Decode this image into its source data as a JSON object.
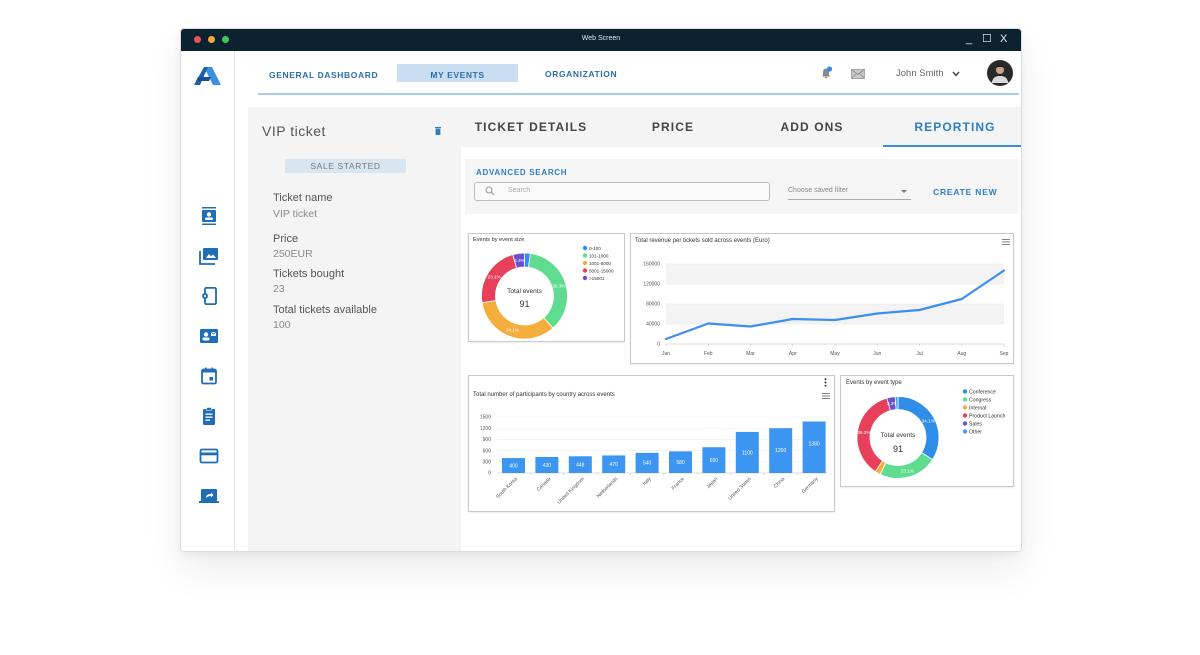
{
  "window": {
    "title": "Web Screen",
    "controls": {
      "minimize": "_",
      "maximize": "☐",
      "close": "X"
    }
  },
  "nav": {
    "items": [
      {
        "label": "GENERAL DASHBOARD",
        "active": false
      },
      {
        "label": "MY EVENTS",
        "active": true
      },
      {
        "label": "ORGANIZATION",
        "active": false
      }
    ],
    "user_name": "John Smith",
    "icons": [
      "bell-icon",
      "mail-icon",
      "chevron-down-icon",
      "avatar"
    ]
  },
  "sidebar": {
    "items": [
      {
        "icon": "contact-badge-icon"
      },
      {
        "icon": "photo-library-icon"
      },
      {
        "icon": "device-settings-icon"
      },
      {
        "icon": "id-card-icon"
      },
      {
        "icon": "calendar-icon"
      },
      {
        "icon": "clipboard-icon"
      },
      {
        "icon": "credit-card-icon"
      },
      {
        "icon": "laptop-share-icon"
      }
    ]
  },
  "ticket": {
    "title": "VIP ticket",
    "status": "SALE STARTED",
    "fields": [
      {
        "label": "Ticket name",
        "value": "VIP ticket"
      },
      {
        "label": "Price",
        "value": "250EUR"
      },
      {
        "label": "Tickets bought",
        "value": "23"
      },
      {
        "label": "Total tickets available",
        "value": "100"
      }
    ]
  },
  "tabs": [
    {
      "label": "TICKET DETAILS",
      "active": false
    },
    {
      "label": "PRICE",
      "active": false
    },
    {
      "label": "ADD ONS",
      "active": false
    },
    {
      "label": "REPORTING",
      "active": true
    }
  ],
  "search": {
    "heading": "ADVANCED SEARCH",
    "placeholder": "Search",
    "filter_placeholder": "Choose saved filter",
    "create_new": "CREATE NEW"
  },
  "colors": {
    "accent": "#2f7fc6",
    "titlebar": "#0d2231",
    "nav_active_bg": "#c9def1",
    "line": "#3a8ff0",
    "bar": "#3d95f2"
  },
  "chart_data": [
    {
      "type": "pie",
      "variant": "donut",
      "title": "Events by event size",
      "center_label": "Total events",
      "center_value": "91",
      "categories": [
        "0-100",
        "101-1000",
        "1001-5000",
        "5001-15000",
        ">15001"
      ],
      "values": [
        2,
        33,
        31,
        21,
        4
      ],
      "pct_labels": [
        "2.2%",
        "36.3%",
        "34.1%",
        "23.1%",
        "4.4%"
      ],
      "colors": [
        "#2f8ff0",
        "#5fdc8f",
        "#f5ad3c",
        "#e8405a",
        "#6a4fd0"
      ],
      "legend": "right"
    },
    {
      "type": "line",
      "title": "Total revenue per tickets sold across events (Euro)",
      "x": [
        "Jan",
        "Feb",
        "Mar",
        "Apr",
        "May",
        "Jun",
        "Jul",
        "Aug",
        "Sep"
      ],
      "series": [
        {
          "name": "Revenue",
          "values": [
            10000,
            41000,
            35000,
            50000,
            48000,
            61000,
            68000,
            90000,
            147000
          ]
        }
      ],
      "yticks": [
        0,
        40000,
        80000,
        120000,
        160000
      ],
      "ylim": [
        0,
        160000
      ],
      "xlabel": "",
      "ylabel": "",
      "grid": true
    },
    {
      "type": "bar",
      "title": "Total number of participants by country across events",
      "categories": [
        "South Korea",
        "Canada",
        "United Kingdom",
        "Netherlands",
        "Italy",
        "France",
        "Japan",
        "United States",
        "China",
        "Germany"
      ],
      "values": [
        400,
        430,
        448,
        470,
        540,
        580,
        690,
        1100,
        1200,
        1380
      ],
      "yticks": [
        0,
        300,
        600,
        900,
        1200,
        1500
      ],
      "ylim": [
        0,
        1500
      ],
      "xlabel": "",
      "ylabel": "",
      "grid": true
    },
    {
      "type": "pie",
      "variant": "donut",
      "title": "Events by event type",
      "center_label": "Total events",
      "center_value": "91",
      "categories": [
        "Conference",
        "Congress",
        "Internal",
        "Product Launch",
        "Sales",
        "Other"
      ],
      "values": [
        31,
        21,
        2,
        33,
        3,
        1
      ],
      "pct_labels": [
        "34.1%",
        "23.1%",
        "2.2%",
        "36.3%",
        "3.3%",
        "1.1%"
      ],
      "colors": [
        "#2e8de8",
        "#5fdc8f",
        "#f5ad3c",
        "#e8405a",
        "#6a4fd0",
        "#3fa3f5"
      ],
      "legend": "right"
    }
  ]
}
